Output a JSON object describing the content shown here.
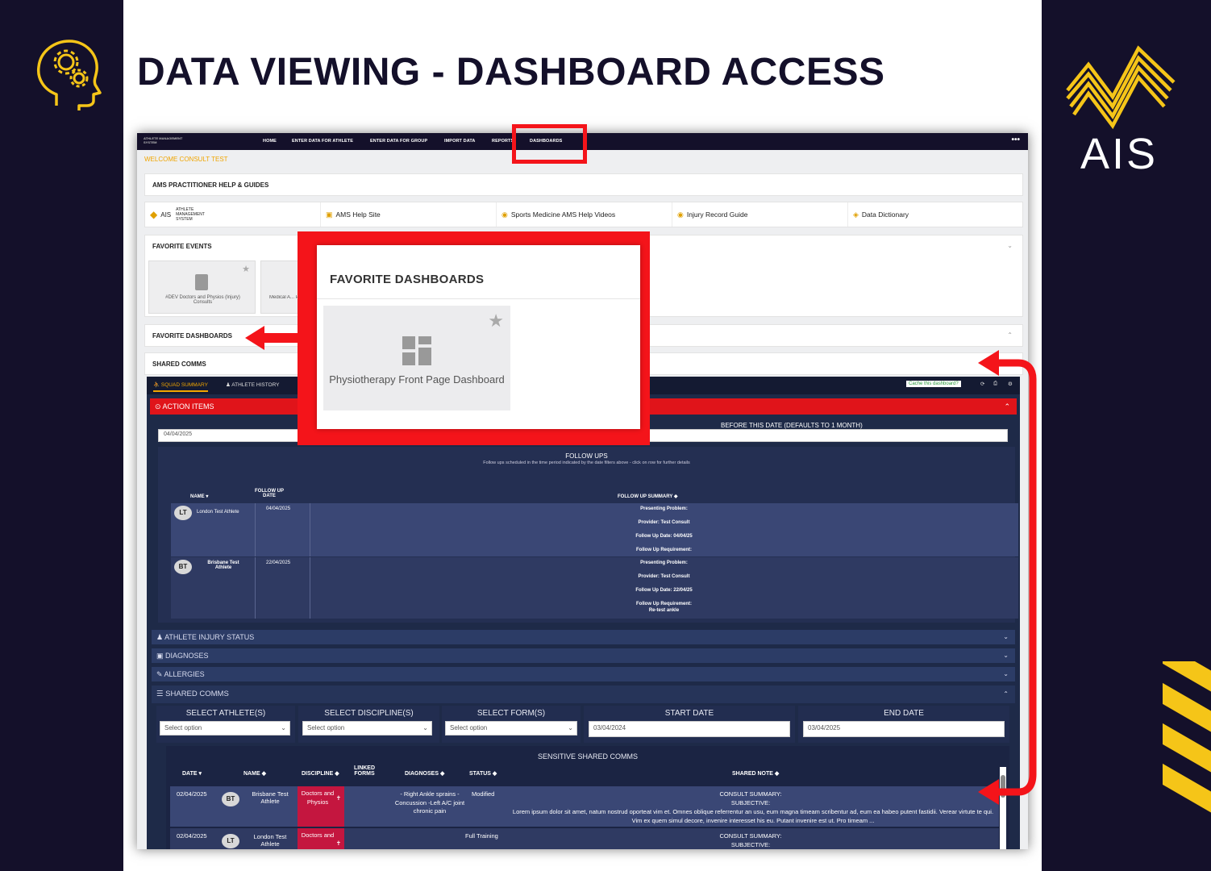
{
  "slide": {
    "title": "DATA VIEWING - DASHBOARD ACCESS",
    "brand": "AIS",
    "accent": "#f5c518",
    "background": "#14102a",
    "highlight_color": "#f4141a"
  },
  "app": {
    "logo_text": "ATHLETE MANAGEMENT SYSTEM",
    "nav": [
      "HOME",
      "ENTER DATA FOR ATHLETE",
      "ENTER DATA FOR GROUP",
      "IMPORT DATA",
      "REPORTS",
      "DASHBOARDS"
    ],
    "nav_more": "•••",
    "welcome": "WELCOME CONSULT TEST",
    "help_card": {
      "title": "AMS PRACTITIONER HELP & GUIDES",
      "logo_brand": "AIS",
      "logo_text": "ATHLETE MANAGEMENT SYSTEM",
      "links": [
        "AMS Help Site",
        "Sports Medicine AMS Help Videos",
        "Injury Record Guide",
        "Data Dictionary"
      ]
    },
    "favorite_events": {
      "title": "FAVORITE EVENTS",
      "tiles": [
        "#DEV Doctors and Physios (Injury) Consults",
        "Medical A... Ph..."
      ]
    },
    "favorite_dashboards_title": "FAVORITE DASHBOARDS",
    "shared_comms_title": "SHARED COMMS",
    "popup": {
      "title": "FAVORITE DASHBOARDS",
      "tile": "Physiotherapy Front Page Dashboard"
    },
    "dashboard": {
      "tabs": [
        "SQUAD SUMMARY",
        "ATHLETE HISTORY"
      ],
      "cache_label": "Cache this dashboard?",
      "action_items": "ACTION ITEMS",
      "before_date_label": "BEFORE THIS DATE (DEFAULTS TO 1 MONTH)",
      "date_value": "04/04/2025",
      "follow_ups": {
        "title": "FOLLOW UPS",
        "subtitle": "Follow ups scheduled in the time period indicated by the date filters above - click on row for further details",
        "columns": [
          "NAME",
          "FOLLOW UP DATE",
          "FOLLOW UP SUMMARY"
        ],
        "rows": [
          {
            "initials": "LT",
            "name": "London Test Athlete",
            "date": "04/04/2025",
            "summary": [
              "Presenting Problem:",
              "Provider: Test Consult",
              "Follow Up Date: 04/04/25",
              "Follow Up Requirement:"
            ]
          },
          {
            "initials": "BT",
            "name": "Brisbane Test Athlete",
            "date": "22/04/2025",
            "summary": [
              "Presenting Problem:",
              "Provider: Test Consult",
              "Follow Up Date: 22/04/25",
              "Follow Up Requirement:",
              "Re-test ankle"
            ]
          }
        ]
      },
      "sections": [
        "ATHLETE INJURY STATUS",
        "DIAGNOSES",
        "ALLERGIES",
        "SHARED COMMS"
      ],
      "filters": [
        {
          "label": "SELECT ATHLETE(S)",
          "value": "Select option"
        },
        {
          "label": "SELECT DISCIPLINE(S)",
          "value": "Select option"
        },
        {
          "label": "SELECT FORM(S)",
          "value": "Select option"
        },
        {
          "label": "START DATE",
          "value": "03/04/2024"
        },
        {
          "label": "END DATE",
          "value": "03/04/2025"
        }
      ],
      "sensitive": {
        "title": "SENSITIVE SHARED COMMS",
        "columns": [
          "DATE",
          "NAME",
          "DISCIPLINE",
          "LINKED FORMS",
          "DIAGNOSES",
          "STATUS",
          "SHARED NOTE"
        ],
        "rows": [
          {
            "date": "02/04/2025",
            "initials": "BT",
            "name": "Brisbane Test Athlete",
            "discipline": "Doctors and Physios",
            "diagnoses": "- Right Ankle sprains -Concussion -Left A/C joint chronic pain",
            "status": "Modified",
            "note_h1": "CONSULT SUMMARY:",
            "note_h2": "SUBJECTIVE:",
            "note": "Lorem ipsum dolor sit amet, natum nostrud oporteat vim et. Omnes oblique referrentur an usu, eum magna timeam scribentur ad, eum ea habeo putent fastidii. Verear virtute te qui. Vim ex quem simul decore, invenire interesset his eu. Putant invenire est ut. Pro timeam ..."
          },
          {
            "date": "02/04/2025",
            "initials": "LT",
            "name": "London Test Athlete",
            "discipline": "Doctors and",
            "diagnoses": "",
            "status": "Full Training",
            "note_h1": "CONSULT SUMMARY:",
            "note_h2": "SUBJECTIVE:",
            "note": ""
          }
        ]
      }
    }
  }
}
